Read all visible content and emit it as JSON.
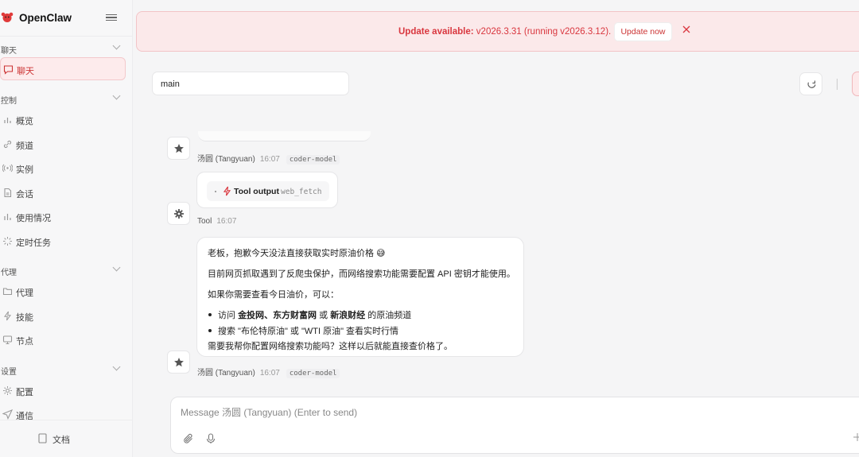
{
  "app": {
    "title": "OpenClaw"
  },
  "sidebar": {
    "sections": [
      {
        "label": "聊天",
        "items": [
          {
            "label": "聊天",
            "icon": "chat-bubble-icon",
            "active": true
          }
        ]
      },
      {
        "label": "控制",
        "items": [
          {
            "label": "概览",
            "icon": "bar-chart-icon"
          },
          {
            "label": "频道",
            "icon": "link-icon"
          },
          {
            "label": "实例",
            "icon": "broadcast-icon"
          },
          {
            "label": "会话",
            "icon": "document-icon"
          },
          {
            "label": "使用情况",
            "icon": "bar-chart-icon"
          },
          {
            "label": "定时任务",
            "icon": "loader-icon"
          }
        ]
      },
      {
        "label": "代理",
        "items": [
          {
            "label": "代理",
            "icon": "folder-icon"
          },
          {
            "label": "技能",
            "icon": "bolt-icon"
          },
          {
            "label": "节点",
            "icon": "monitor-icon"
          }
        ]
      },
      {
        "label": "设置",
        "items": [
          {
            "label": "配置",
            "icon": "gear-icon"
          },
          {
            "label": "通信",
            "icon": "send-icon"
          }
        ]
      }
    ],
    "docs_label": "文档"
  },
  "banner": {
    "title": "Update available:",
    "detail": "v2026.3.31 (running v2026.3.12).",
    "button": "Update now"
  },
  "session": {
    "name": "main"
  },
  "messages": {
    "first_meta": {
      "sender": "汤圆 (Tangyuan)",
      "time": "16:07",
      "model": "coder-model"
    },
    "tool": {
      "label": "Tool output",
      "tool_name": "web_fetch",
      "sender": "Tool",
      "time": "16:07"
    },
    "reply": {
      "line1": "老板，抱歉今天没法直接获取实时原油价格 😅",
      "line2": "目前网页抓取遇到了反爬虫保护，而网络搜索功能需要配置 API 密钥才能使用。",
      "line3": "如果你需要查看今日油价，可以：",
      "bullet1_pre": "访问 ",
      "bullet1_b1": "金投网",
      "bullet1_sep": "、",
      "bullet1_b2": "东方财富网",
      "bullet1_or": " 或 ",
      "bullet1_b3": "新浪财经",
      "bullet1_post": " 的原油频道",
      "bullet2": "搜索 \"布伦特原油\" 或 \"WTI 原油\" 查看实时行情",
      "line4": "需要我帮你配置网络搜索功能吗？这样以后就能直接查价格了。"
    },
    "reply_meta": {
      "sender": "汤圆 (Tangyuan)",
      "time": "16:07",
      "model": "coder-model"
    }
  },
  "composer": {
    "placeholder": "Message 汤圆 (Tangyuan) (Enter to send)",
    "value": ""
  },
  "colors": {
    "accent": "#d9363e",
    "accent_bg": "#fdebec",
    "banner_bg": "#fbe9ea"
  }
}
